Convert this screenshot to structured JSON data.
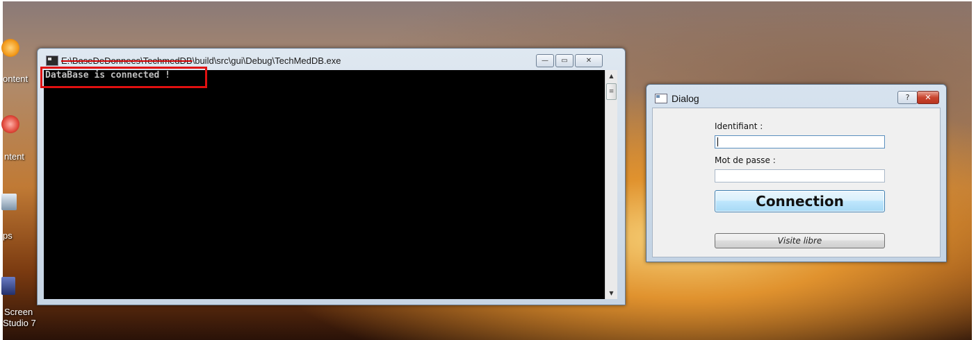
{
  "desktop": {
    "icons": [
      {
        "label": "ontent",
        "name": "content-icon-1"
      },
      {
        "label": "ntent",
        "name": "content-icon-2"
      },
      {
        "label": "ps",
        "name": "apps-icon"
      },
      {
        "label": "Screen",
        "label2": "Studio 7",
        "name": "screen-studio-icon"
      }
    ]
  },
  "console": {
    "title_obscured": "E:\\BaseDeDonnees\\TechmedDB",
    "title_rest": "\\build\\src\\gui\\Debug\\TechMedDB.exe",
    "output_line": "DataBase is connected !",
    "buttons": {
      "minimize": "—",
      "maximize": "▭",
      "close": "✕"
    },
    "scroll_up": "▲",
    "scroll_down": "▼",
    "scroll_thumb": "≡"
  },
  "dialog": {
    "title": "Dialog",
    "help_label": "?",
    "close_label": "✕",
    "login_label": "Identifiant :",
    "login_value": "",
    "password_label": "Mot de passe :",
    "password_value": "",
    "connect_label": "Connection",
    "free_visit_label": "Visite libre"
  },
  "colors": {
    "highlight": "#e01010",
    "console_bg": "#000000",
    "console_text": "#c0c0c0",
    "primary_button": "#a7d9f5"
  }
}
